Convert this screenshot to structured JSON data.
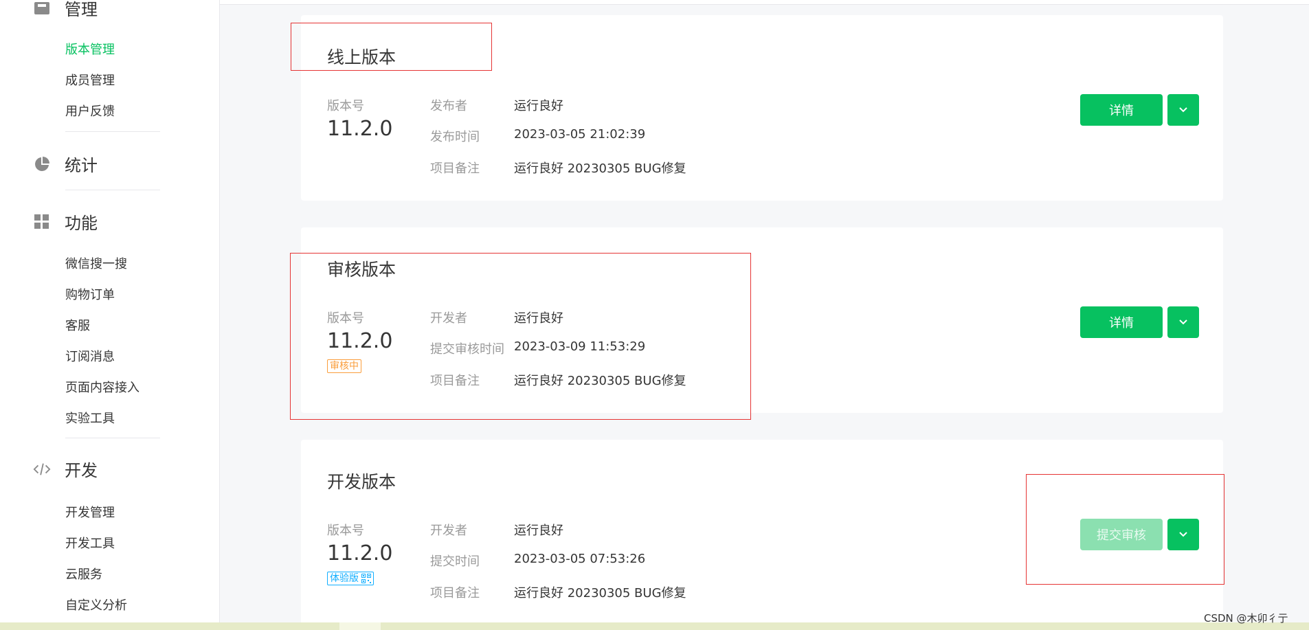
{
  "sidebar": {
    "top_section": {
      "icon": "mailbox-icon",
      "label": "管理"
    },
    "manage_items": [
      {
        "label": "版本管理",
        "active": true
      },
      {
        "label": "成员管理"
      },
      {
        "label": "用户反馈"
      }
    ],
    "stats": {
      "icon": "pie-chart-icon",
      "label": "统计"
    },
    "features": {
      "icon": "grid-icon",
      "label": "功能"
    },
    "feature_items": [
      {
        "label": "微信搜一搜"
      },
      {
        "label": "购物订单"
      },
      {
        "label": "客服"
      },
      {
        "label": "订阅消息"
      },
      {
        "label": "页面内容接入"
      },
      {
        "label": "实验工具"
      }
    ],
    "dev": {
      "icon": "code-icon",
      "label": "开发"
    },
    "dev_items": [
      {
        "label": "开发管理"
      },
      {
        "label": "开发工具"
      },
      {
        "label": "云服务"
      },
      {
        "label": "自定义分析"
      }
    ]
  },
  "cards": {
    "online": {
      "title": "线上版本",
      "version_label": "版本号",
      "version": "11.2.0",
      "fields": [
        {
          "label": "发布者",
          "value": "运行良好"
        },
        {
          "label": "发布时间",
          "value": "2023-03-05 21:02:39"
        },
        {
          "label": "项目备注",
          "value": "运行良好 20230305 BUG修复"
        }
      ],
      "button": "详情"
    },
    "review": {
      "title": "审核版本",
      "version_label": "版本号",
      "version": "11.2.0",
      "badge": "审核中",
      "fields": [
        {
          "label": "开发者",
          "value": "运行良好"
        },
        {
          "label": "提交审核时间",
          "value": "2023-03-09 11:53:29"
        },
        {
          "label": "项目备注",
          "value": "运行良好 20230305 BUG修复"
        }
      ],
      "button": "详情"
    },
    "dev": {
      "title": "开发版本",
      "version_label": "版本号",
      "version": "11.2.0",
      "badge": "体验版",
      "fields": [
        {
          "label": "开发者",
          "value": "运行良好"
        },
        {
          "label": "提交时间",
          "value": "2023-03-05 07:53:26"
        },
        {
          "label": "项目备注",
          "value": "运行良好 20230305 BUG修复"
        }
      ],
      "button": "提交审核"
    }
  },
  "watermark": "CSDN @木卯彳亍",
  "colors": {
    "brand": "#07c160",
    "brand_disabled": "#8be0b0",
    "review_badge": "#fa9d3b",
    "trial_badge": "#10aeff",
    "annotation": "#e53333"
  }
}
